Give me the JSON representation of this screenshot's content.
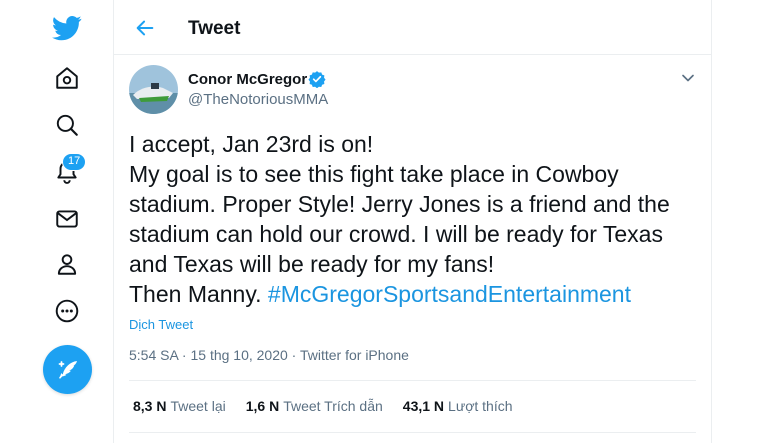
{
  "colors": {
    "accent": "#1da1f2",
    "link": "#1b95e0",
    "secondary_text": "#5b7083",
    "border": "#ebeef0"
  },
  "sidebar": {
    "items": [
      {
        "icon": "twitter-logo-icon"
      },
      {
        "icon": "home-icon"
      },
      {
        "icon": "explore-search-icon"
      },
      {
        "icon": "notifications-bell-icon",
        "badge": "17"
      },
      {
        "icon": "messages-envelope-icon"
      },
      {
        "icon": "profile-person-icon"
      },
      {
        "icon": "more-circle-icon"
      },
      {
        "icon": "compose-tweet-icon"
      }
    ]
  },
  "header": {
    "title": "Tweet"
  },
  "tweet": {
    "author_name": "Conor McGregor",
    "author_handle": "@TheNotoriousMMA",
    "lines": [
      "I accept, Jan 23rd is on!",
      "My goal is to see this fight take place in Cowboy",
      "stadium. Proper Style! Jerry Jones is a friend and the",
      "stadium can hold our crowd. I will be ready for Texas",
      "and Texas will be ready for my fans!"
    ],
    "last_line_prefix": "Then Manny.",
    "hashtag": "#McGregorSportsandEntertainment",
    "translate_label": "Dịch Tweet",
    "timestamp": "5:54 SA · 15 thg 10, 2020 · Twitter for iPhone"
  },
  "stats": [
    {
      "value": "8,3 N",
      "label": "Tweet lại"
    },
    {
      "value": "1,6 N",
      "label": "Tweet Trích dẫn"
    },
    {
      "value": "43,1 N",
      "label": "Lượt thích"
    }
  ]
}
